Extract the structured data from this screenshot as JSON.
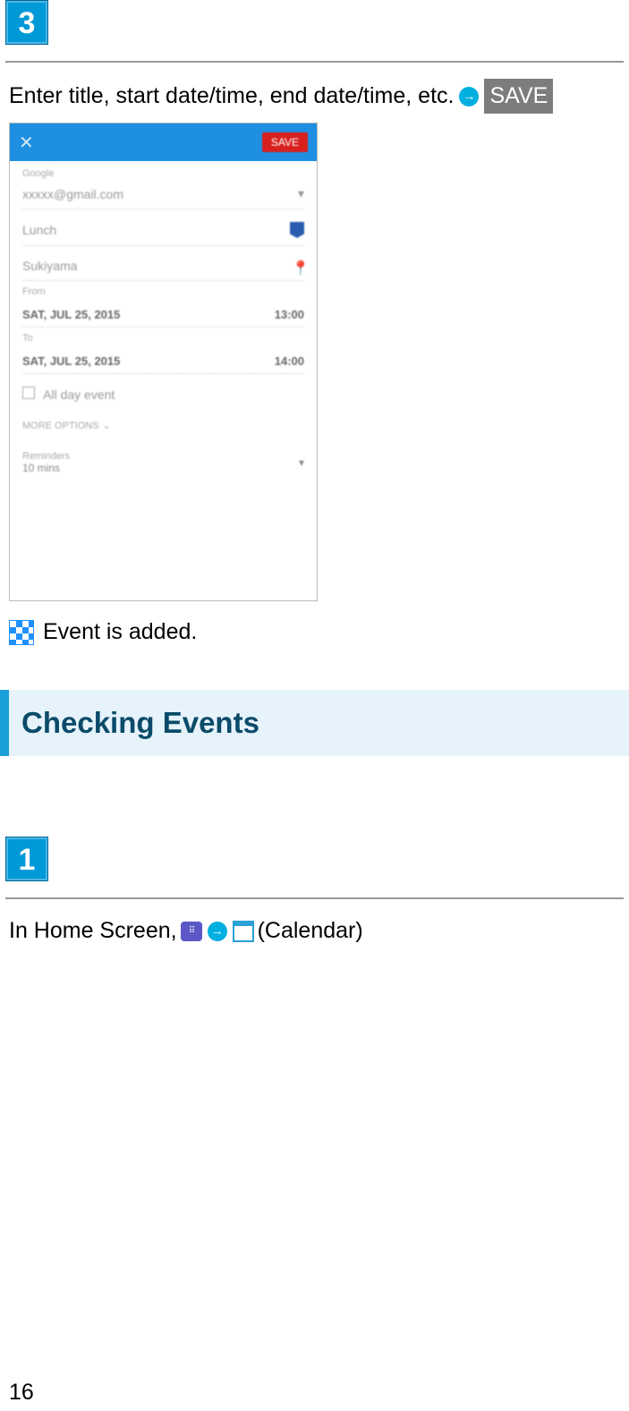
{
  "step3": {
    "badge": "3",
    "text": "Enter title, start date/time, end date/time, etc.",
    "save_label": "SAVE"
  },
  "phone": {
    "close": "✕",
    "save": "SAVE",
    "account_label": "Google",
    "account_value": "xxxxx@gmail.com",
    "title_value": "Lunch",
    "location_value": "Sukiyama",
    "from_label": "From",
    "from_date": "SAT, JUL 25, 2015",
    "from_time": "13:00",
    "to_label": "To",
    "to_date": "SAT, JUL 25, 2015",
    "to_time": "14:00",
    "allday_label": "All day event",
    "more_label": "MORE OPTIONS",
    "reminder_label": "Reminders",
    "reminder_value": "10 mins"
  },
  "result": {
    "text": "Event is added."
  },
  "section": {
    "title": "Checking Events"
  },
  "step1": {
    "badge": "1",
    "prefix": "In Home Screen, ",
    "suffix": " (Calendar)"
  },
  "page_number": "16"
}
